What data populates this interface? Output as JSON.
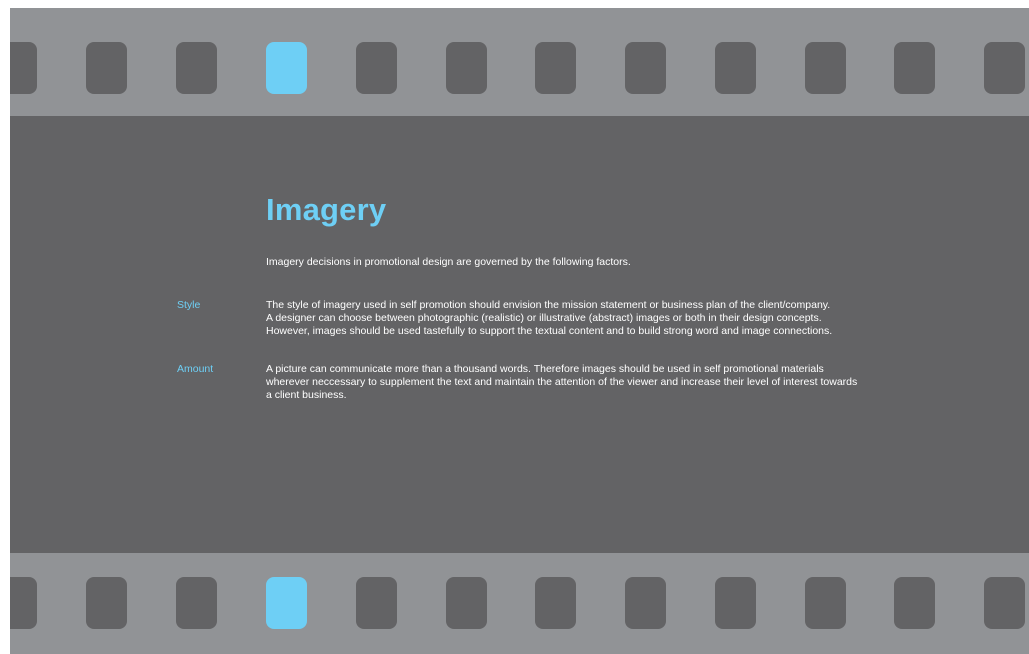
{
  "colors": {
    "strip": "#919396",
    "panel": "#636365",
    "hole": "#636365",
    "accent": "#6ecff5",
    "text": "#ffffff"
  },
  "filmstrip": {
    "hole_count": 12,
    "highlighted_index": 3
  },
  "title": "Imagery",
  "intro": "Imagery decisions in promotional design are governed by the following factors.",
  "factors": [
    {
      "label": "Style",
      "lines": [
        "The style of imagery used in self promotion should envision the mission statement or business plan of the client/company.",
        "A designer can choose between photographic (realistic) or illustrative (abstract) images or both in their design concepts.",
        "However, images should be used tastefully to support the textual content and to build strong word and image connections."
      ]
    },
    {
      "label": "Amount",
      "lines": [
        "A picture can communicate more than a thousand words. Therefore images should be used in self promotional materials",
        "wherever neccessary to supplement the text and maintain the attention of the viewer and increase their level of interest towards",
        "a client business."
      ]
    }
  ]
}
